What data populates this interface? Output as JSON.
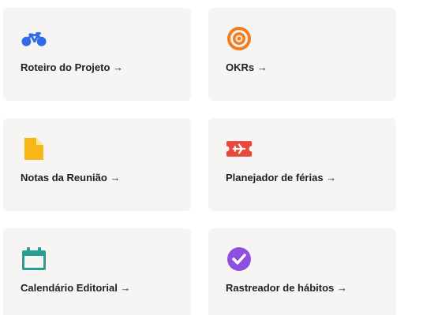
{
  "cards": [
    {
      "label": "Roteiro do Projeto →",
      "icon": "bicycle-icon",
      "color": "#2f6ce6"
    },
    {
      "label": "OKRs →",
      "icon": "target-icon",
      "color": "#f57c1f"
    },
    {
      "label": "Notas da Reunião →",
      "icon": "document-icon",
      "color": "#f7b718"
    },
    {
      "label": "Planejador de férias →",
      "icon": "airplane-ticket-icon",
      "color": "#e8473b"
    },
    {
      "label": "Calendário Editorial →",
      "icon": "calendar-icon",
      "color": "#2a9d8f"
    },
    {
      "label": "Rastreador de hábitos →",
      "icon": "check-circle-icon",
      "color": "#8e4fe0"
    }
  ]
}
